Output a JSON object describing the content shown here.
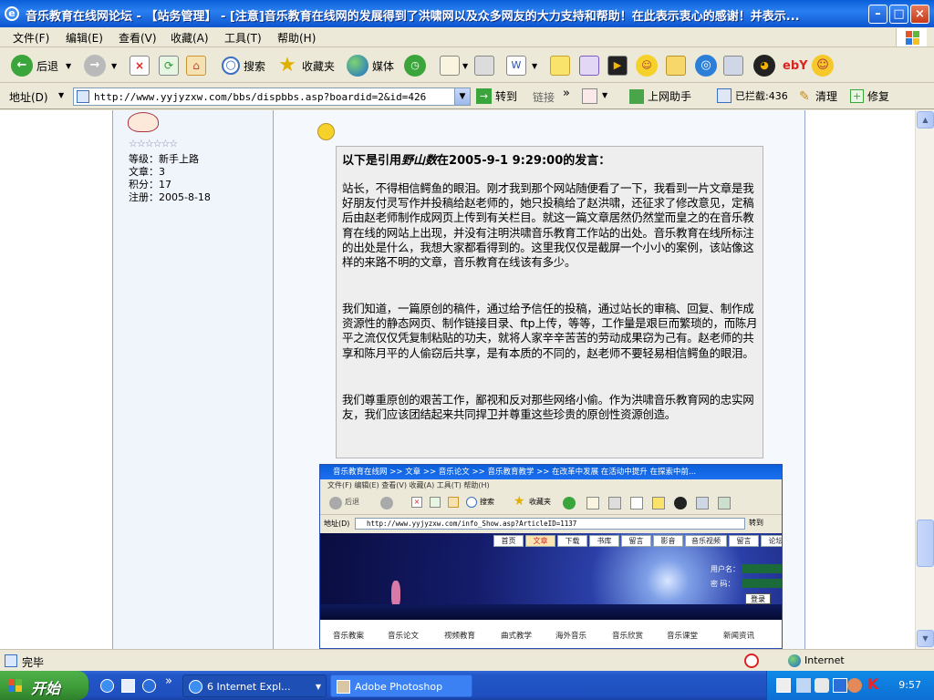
{
  "window": {
    "title": "音乐教育在线网论坛 - 【站务管理】 - [注意]音乐教育在线网的发展得到了洪啸网以及众多网友的大力支持和帮助！在此表示衷心的感谢！并表示..."
  },
  "menu": [
    "文件(F)",
    "编辑(E)",
    "查看(V)",
    "收藏(A)",
    "工具(T)",
    "帮助(H)"
  ],
  "toolbar": {
    "back": "后退",
    "search": "搜索",
    "favorites": "收藏夹",
    "media": "媒体"
  },
  "address": {
    "label": "地址(D)",
    "url": "http://www.yyjyzxw.com/bbs/dispbbs.asp?boardid=2&id=426",
    "go": "转到",
    "links": "链接",
    "helper": "上网助手",
    "blocked": "已拦截:436",
    "clean": "清理",
    "repair": "修复"
  },
  "post": {
    "user": {
      "stars": "☆☆☆☆☆☆",
      "level": "等级：新手上路",
      "articles": "文章：3",
      "points": "积分：17",
      "registered": "注册：2005-8-18"
    },
    "quote": {
      "head_prefix": "以下是引用",
      "author": "野山数",
      "head_suffix": "在2005-9-1 9:29:00的发言：",
      "paragraphs": [
        "站长，不得相信鳄鱼的眼泪。刚才我到那个网站随便看了一下，我看到一片文章是我好朋友付灵写作并投稿给赵老师的，她只投稿给了赵洪啸，还征求了修改意见，定稿后由赵老师制作成网页上传到有关栏目。就这一篇文章居然仍然堂而皇之的在音乐教育在线的网站上出现，并没有注明洪啸音乐教育工作站的出处。音乐教育在线所标注的出处是什么，我想大家都看得到的。这里我仅仅是截屏一个小小的案例，该站像这样的来路不明的文章，音乐教育在线该有多少。",
        "我们知道，一篇原创的稿件，通过给予信任的投稿，通过站长的审稿、回复、制作成资源性的静态网页、制作链接目录、ftp上传，等等，工作量是艰巨而繁琐的，而陈月平之流仅仅凭复制粘贴的功夫，就将人家辛辛苦苦的劳动成果窃为己有。赵老师的共享和陈月平的人偷窃后共享，是有本质的不同的，赵老师不要轻易相信鳄鱼的眼泪。",
        "我们尊重原创的艰苦工作，鄙视和反对那些网络小偷。作为洪啸音乐教育网的忠实网友，我们应该团结起来共同捍卫并尊重这些珍贵的原创性资源创造。"
      ]
    }
  },
  "embedded": {
    "title": "音乐教育在线网 >> 文章 >> 音乐论文 >> 音乐教育教学 >> 在改革中发展 在活动中提升 在探索中前...",
    "menu": "文件(F)   编辑(E)   查看(V)   收藏(A)   工具(T)   帮助(H)",
    "back": "后退",
    "search": "搜索",
    "fav": "收藏夹",
    "addr_label": "地址(D)",
    "url": "http://www.yyjyzxw.com/info_Show.asp?ArticleID=1137",
    "go": "转到",
    "tabs": [
      "首页",
      "文章",
      "下载",
      "书库",
      "留言",
      "影音",
      "音乐视频",
      "留言",
      "论坛"
    ],
    "login_user": "用户名：",
    "login_pass": "密  码：",
    "login_btn": "登录",
    "nav": [
      "音乐教案",
      "音乐论文",
      "视频教育",
      "曲式教学",
      "海外音乐",
      "音乐欣赏",
      "音乐课堂",
      "新闻资讯"
    ]
  },
  "status": {
    "text": "完毕",
    "zone": "Internet"
  },
  "taskbar": {
    "start": "开始",
    "tasks": [
      "6 Internet Expl...",
      "Adobe Photoshop"
    ],
    "clock": "9:57"
  }
}
